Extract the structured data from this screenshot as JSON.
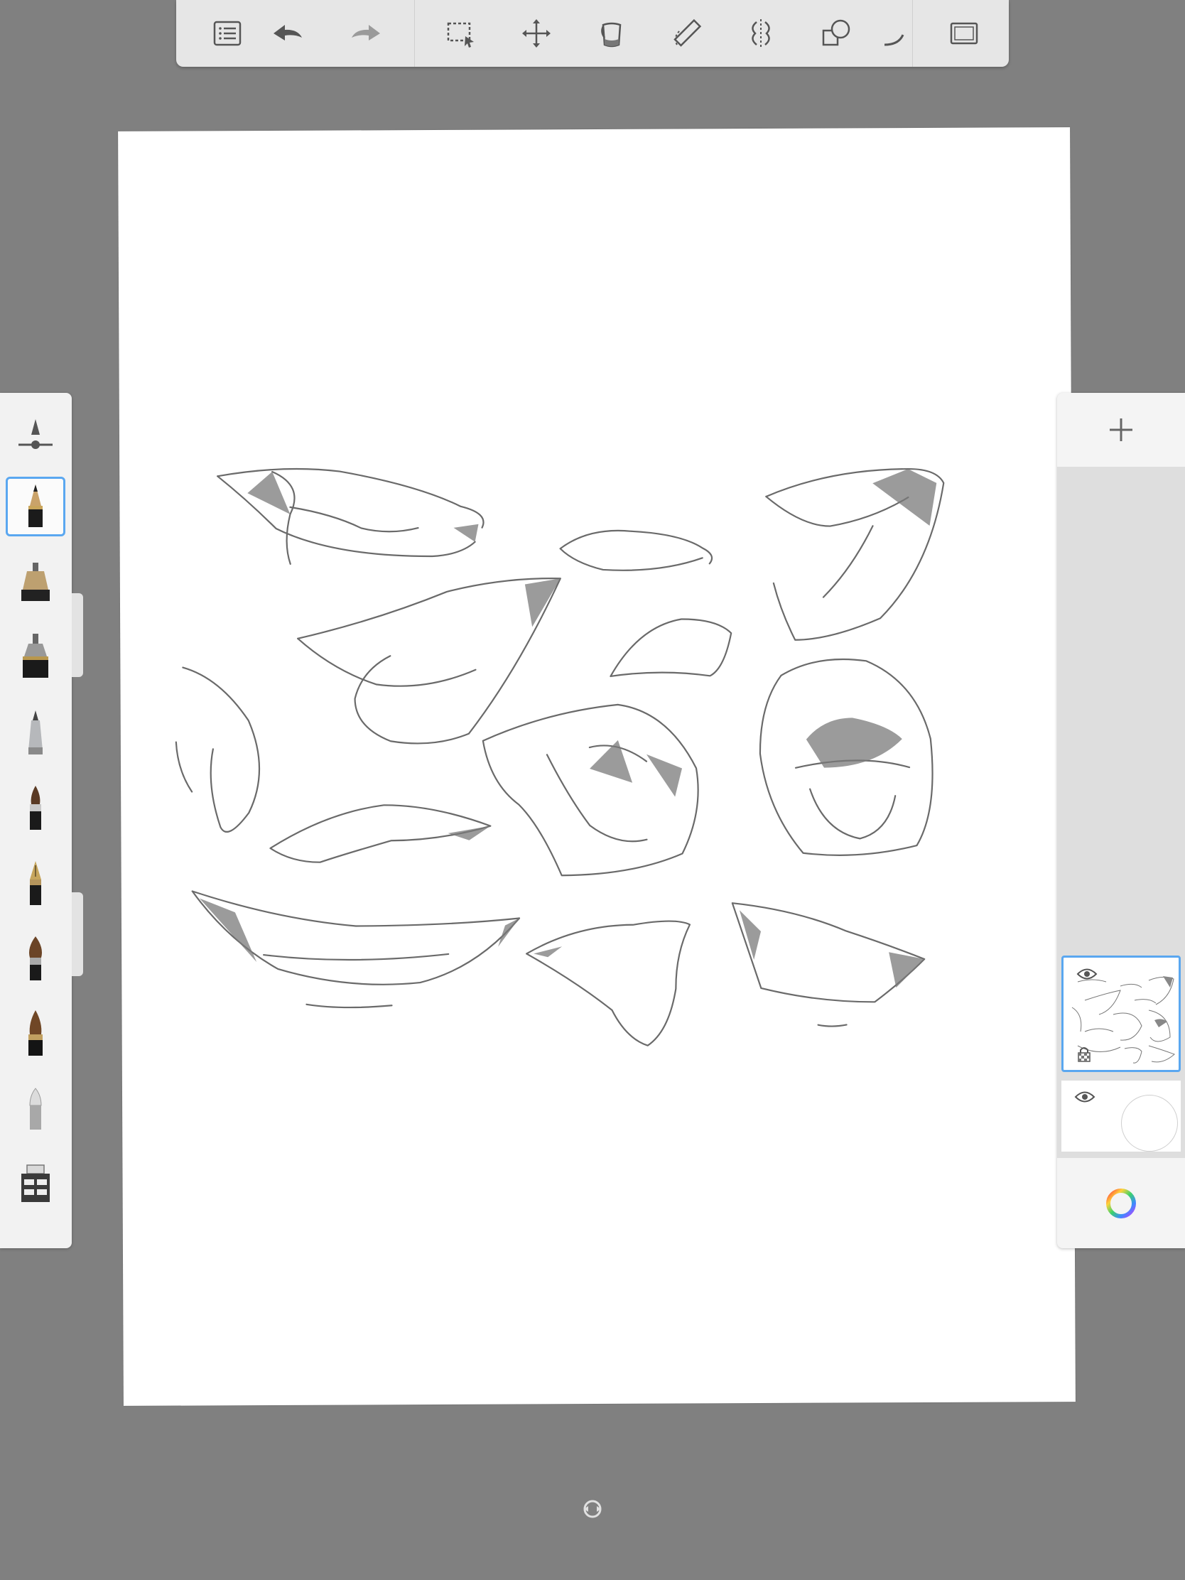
{
  "toolbar": {
    "items": [
      {
        "name": "list-icon"
      },
      {
        "name": "undo-icon"
      },
      {
        "name": "redo-icon"
      },
      {
        "name": "selection-icon"
      },
      {
        "name": "transform-icon"
      },
      {
        "name": "fill-bucket-icon"
      },
      {
        "name": "ruler-icon"
      },
      {
        "name": "symmetry-icon"
      },
      {
        "name": "shapes-icon"
      },
      {
        "name": "curve-icon"
      },
      {
        "name": "fullscreen-icon"
      }
    ]
  },
  "brushes": {
    "selected": "pencil",
    "items": [
      "brush-size-control",
      "pencil",
      "paint-bucket-brush",
      "ink-pen",
      "marker",
      "paint-brush",
      "fountain-pen",
      "flat-brush",
      "round-brush",
      "eraser",
      "brush-library"
    ]
  },
  "layers": {
    "add_button": "add-layer-icon",
    "layer_list": [
      {
        "name": "drawing-layer",
        "visible": true,
        "active": true
      },
      {
        "name": "background-layer",
        "visible": true,
        "active": false
      }
    ],
    "color_button": "color-wheel-icon"
  },
  "colors": {
    "background": "#808080",
    "panel": "#f2f2f2",
    "accent": "#5aa7f0"
  }
}
